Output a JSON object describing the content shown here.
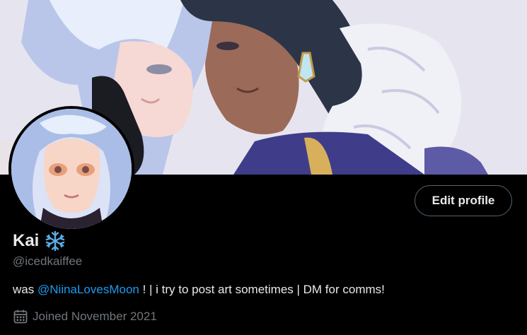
{
  "profile": {
    "display_name": "Kai",
    "name_emoji": "snowflake-emoji",
    "handle": "@icedkaiffee",
    "bio_prefix": "was ",
    "bio_mention": "@NiinaLovesMoon",
    "bio_suffix": " ! | i try to post art sometimes | DM for comms!",
    "joined": "Joined November 2021"
  },
  "actions": {
    "edit_profile_label": "Edit profile"
  },
  "icons": {
    "joined": "calendar-icon"
  },
  "colors": {
    "background": "#000000",
    "text_primary": "#e7e9ea",
    "text_secondary": "#71767b",
    "link": "#1d9bf0",
    "button_border": "#536471",
    "snowflake": "#5aaee8"
  }
}
